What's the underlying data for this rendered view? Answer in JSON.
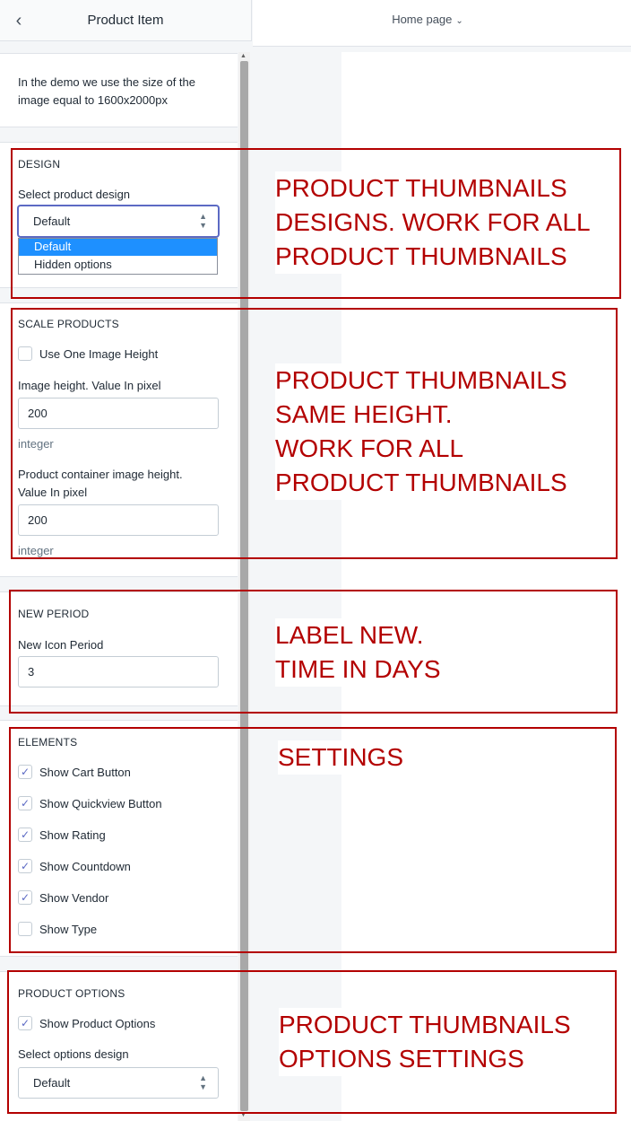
{
  "header": {
    "back_icon": "chevron-left-icon",
    "title": "Product Item"
  },
  "topbar": {
    "page_selector": "Home page",
    "chevron_icon": "chevron-down-icon"
  },
  "info": {
    "text": "In the demo we use the size of the image equal to 1600x2000px"
  },
  "design": {
    "heading": "DESIGN",
    "select_label": "Select product design",
    "select_value": "Default",
    "options": [
      "Default",
      "Hidden options"
    ],
    "selected_option": "Default"
  },
  "scale": {
    "heading": "SCALE PRODUCTS",
    "one_height_label": "Use One Image Height",
    "one_height_checked": false,
    "height_label": "Image height. Value In pixel",
    "height_value": "200",
    "height_hint": "integer",
    "container_label_1": "Product container image height.",
    "container_label_2": "Value In pixel",
    "container_value": "200",
    "container_hint": "integer"
  },
  "new_period": {
    "heading": "NEW PERIOD",
    "label": "New Icon Period",
    "value": "3"
  },
  "elements": {
    "heading": "ELEMENTS",
    "items": [
      {
        "label": "Show Cart Button",
        "checked": true
      },
      {
        "label": "Show Quickview Button",
        "checked": true
      },
      {
        "label": "Show Rating",
        "checked": true
      },
      {
        "label": "Show Countdown",
        "checked": true
      },
      {
        "label": "Show Vendor",
        "checked": true
      },
      {
        "label": "Show Type",
        "checked": false
      }
    ]
  },
  "product_options": {
    "heading": "PRODUCT OPTIONS",
    "show_label": "Show Product Options",
    "show_checked": true,
    "select_label": "Select options design",
    "select_value": "Default"
  },
  "annotations": {
    "design": "PRODUCT THUMBNAILS\nDESIGNS. WORK FOR ALL\nPRODUCT THUMBNAILS",
    "scale": "PRODUCT THUMBNAILS\nSAME HEIGHT.\nWORK FOR ALL\nPRODUCT THUMBNAILS",
    "new_period": "LABEL NEW.\nTIME IN DAYS",
    "elements": "SETTINGS",
    "product_options": "PRODUCT THUMBNAILS\nOPTIONS SETTINGS"
  },
  "colors": {
    "annotation": "#b30000",
    "accent": "#5c6ac4",
    "highlight": "#1e90ff"
  }
}
